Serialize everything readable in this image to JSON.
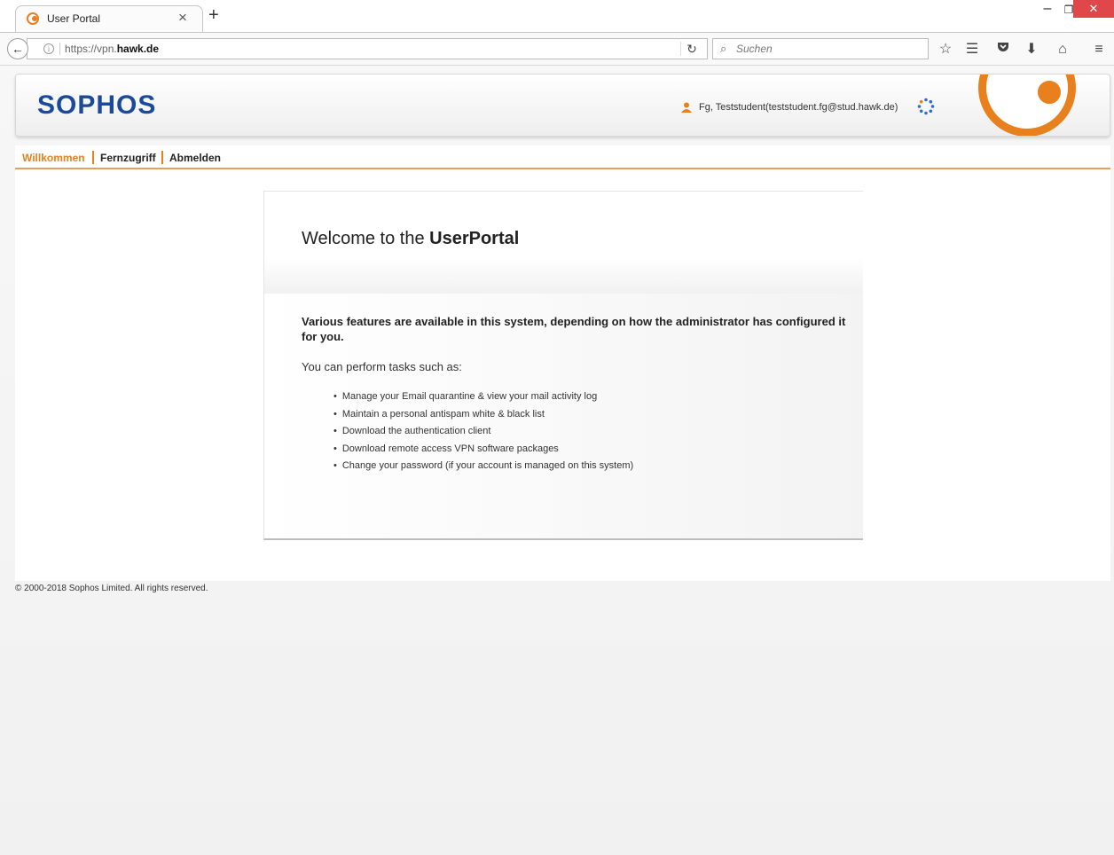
{
  "browser": {
    "tab_title": "User Portal",
    "tab_close": "×",
    "new_tab": "+",
    "url_prefix": "https://vpn.",
    "url_domain": "hawk.de",
    "search_placeholder": "Suchen",
    "window_controls": {
      "minimize": "–",
      "maximize": "❐",
      "close": "✕"
    }
  },
  "header": {
    "logo": "SOPHOS",
    "user": "Fg, Teststudent(teststudent.fg@stud.hawk.de)"
  },
  "menu": {
    "items": [
      {
        "label": "Willkommen",
        "active": true
      },
      {
        "label": "Fernzugriff",
        "active": false
      },
      {
        "label": "Abmelden",
        "active": false
      }
    ]
  },
  "welcome": {
    "title_prefix": "Welcome to the ",
    "title_bold": "UserPortal",
    "intro": "Various features are available in this system, depending on how the administrator has configured it for you.",
    "tasks_intro": "You can perform tasks such as:",
    "tasks": [
      "Manage your Email quarantine & view your mail activity log",
      "Maintain a personal antispam white & black list",
      "Download the authentication client",
      "Download remote access VPN software packages",
      "Change your password (if your account is managed on this system)"
    ]
  },
  "footer": {
    "copyright": "© 2000-2018 Sophos Limited. All rights reserved."
  },
  "colors": {
    "brand_blue": "#1b4a9b",
    "accent_orange": "#e8801e",
    "close_red": "#e0474b"
  }
}
